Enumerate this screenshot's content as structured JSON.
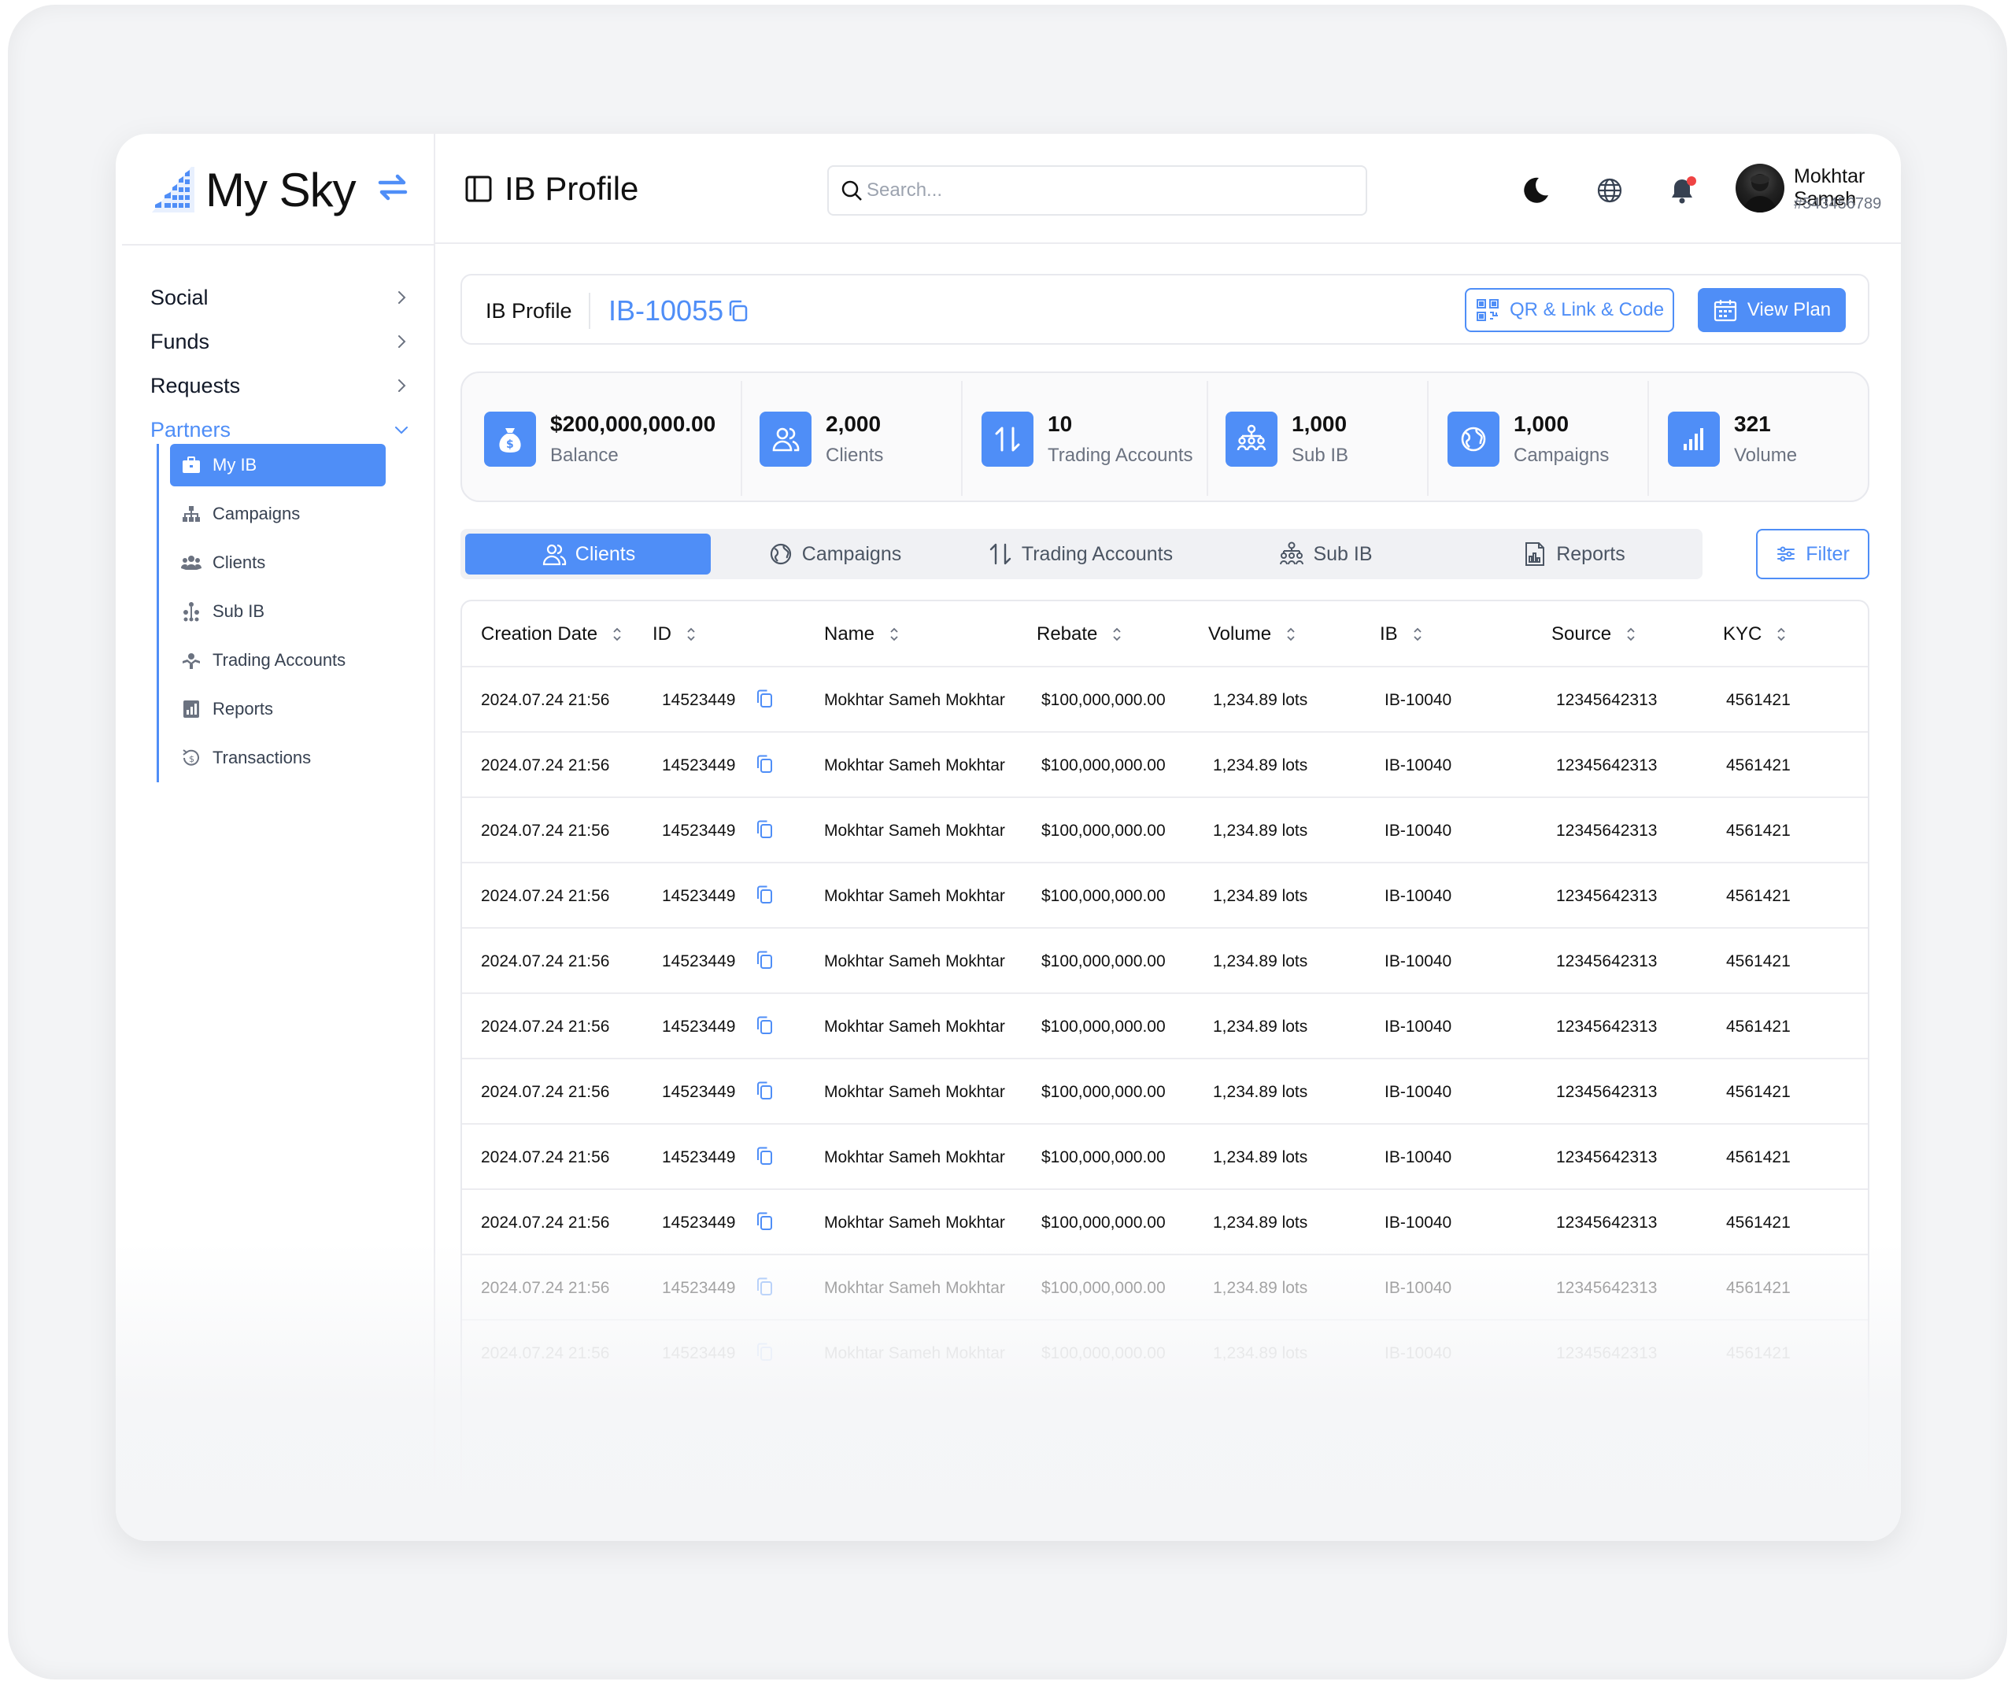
{
  "app": {
    "name": "My Sky"
  },
  "sidebar": {
    "items": [
      {
        "label": "Social"
      },
      {
        "label": "Funds"
      },
      {
        "label": "Requests"
      },
      {
        "label": "Partners"
      }
    ],
    "sub_items": [
      {
        "label": "My IB"
      },
      {
        "label": "Campaigns"
      },
      {
        "label": "Clients"
      },
      {
        "label": "Sub IB"
      },
      {
        "label": "Trading Accounts"
      },
      {
        "label": "Reports"
      },
      {
        "label": "Transactions"
      }
    ]
  },
  "header": {
    "title": "IB Profile",
    "search_placeholder": "Search...",
    "user": {
      "name": "Mokhtar Sameh",
      "id": "#543456789"
    }
  },
  "profile": {
    "label": "IB Profile",
    "ib_id": "IB-10055",
    "qr_button": "QR & Link & Code",
    "plan_button": "View Plan"
  },
  "stats": [
    {
      "value": "$200,000,000.00",
      "label": "Balance",
      "icon": "money-bag-icon"
    },
    {
      "value": "2,000",
      "label": "Clients",
      "icon": "users-icon"
    },
    {
      "value": "10",
      "label": "Trading Accounts",
      "icon": "arrows-up-down-icon"
    },
    {
      "value": "1,000",
      "label": "Sub IB",
      "icon": "hierarchy-icon"
    },
    {
      "value": "1,000",
      "label": "Campaigns",
      "icon": "globe-campaign-icon"
    },
    {
      "value": "321",
      "label": "Volume",
      "icon": "bar-chart-icon"
    }
  ],
  "tabs": [
    {
      "label": "Clients"
    },
    {
      "label": "Campaigns"
    },
    {
      "label": "Trading Accounts"
    },
    {
      "label": "Sub IB"
    },
    {
      "label": "Reports"
    }
  ],
  "filter_label": "Filter",
  "table": {
    "columns": [
      "Creation Date",
      "ID",
      "Name",
      "Rebate",
      "Volume",
      "IB",
      "Source",
      "KYC"
    ],
    "rows": [
      [
        "2024.07.24 21:56",
        "14523449",
        "Mokhtar Sameh Mokhtar",
        "$100,000,000.00",
        "1,234.89 lots",
        "IB-10040",
        "12345642313",
        "4561421"
      ],
      [
        "2024.07.24 21:56",
        "14523449",
        "Mokhtar Sameh Mokhtar",
        "$100,000,000.00",
        "1,234.89 lots",
        "IB-10040",
        "12345642313",
        "4561421"
      ],
      [
        "2024.07.24 21:56",
        "14523449",
        "Mokhtar Sameh Mokhtar",
        "$100,000,000.00",
        "1,234.89 lots",
        "IB-10040",
        "12345642313",
        "4561421"
      ],
      [
        "2024.07.24 21:56",
        "14523449",
        "Mokhtar Sameh Mokhtar",
        "$100,000,000.00",
        "1,234.89 lots",
        "IB-10040",
        "12345642313",
        "4561421"
      ],
      [
        "2024.07.24 21:56",
        "14523449",
        "Mokhtar Sameh Mokhtar",
        "$100,000,000.00",
        "1,234.89 lots",
        "IB-10040",
        "12345642313",
        "4561421"
      ],
      [
        "2024.07.24 21:56",
        "14523449",
        "Mokhtar Sameh Mokhtar",
        "$100,000,000.00",
        "1,234.89 lots",
        "IB-10040",
        "12345642313",
        "4561421"
      ],
      [
        "2024.07.24 21:56",
        "14523449",
        "Mokhtar Sameh Mokhtar",
        "$100,000,000.00",
        "1,234.89 lots",
        "IB-10040",
        "12345642313",
        "4561421"
      ],
      [
        "2024.07.24 21:56",
        "14523449",
        "Mokhtar Sameh Mokhtar",
        "$100,000,000.00",
        "1,234.89 lots",
        "IB-10040",
        "12345642313",
        "4561421"
      ],
      [
        "2024.07.24 21:56",
        "14523449",
        "Mokhtar Sameh Mokhtar",
        "$100,000,000.00",
        "1,234.89 lots",
        "IB-10040",
        "12345642313",
        "4561421"
      ],
      [
        "2024.07.24 21:56",
        "14523449",
        "Mokhtar Sameh Mokhtar",
        "$100,000,000.00",
        "1,234.89 lots",
        "IB-10040",
        "12345642313",
        "4561421"
      ],
      [
        "2024.07.24 21:56",
        "14523449",
        "Mokhtar Sameh Mokhtar",
        "$100,000,000.00",
        "1,234.89 lots",
        "IB-10040",
        "12345642313",
        "4561421"
      ]
    ]
  },
  "colors": {
    "accent": "#4f8ef7",
    "notification": "#ef4444",
    "text": "#111827",
    "muted": "#6b7280"
  }
}
